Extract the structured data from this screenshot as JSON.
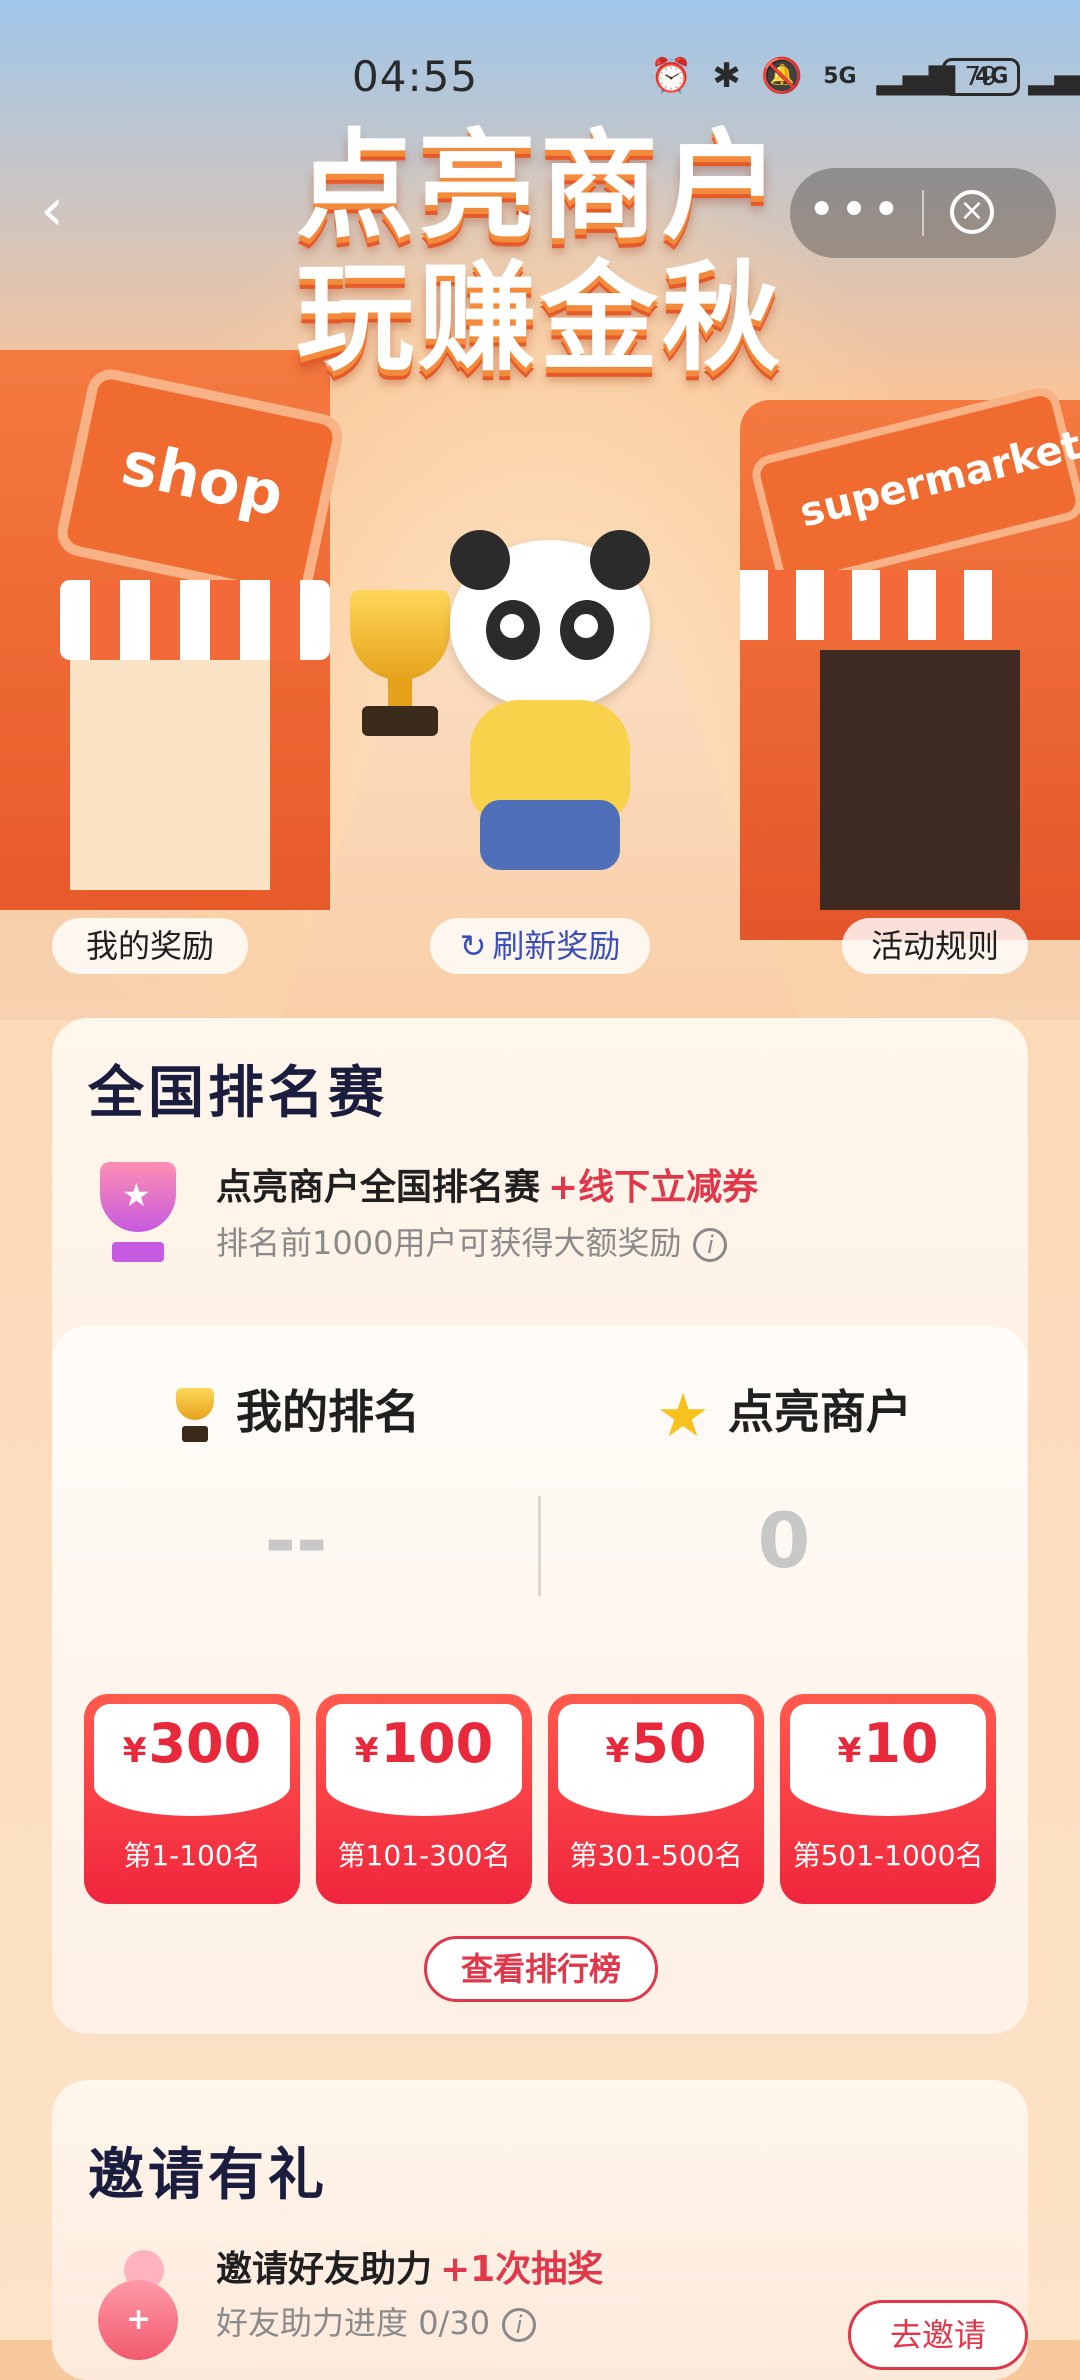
{
  "status_bar": {
    "time": "04:55",
    "network_1": "5G",
    "network_2": "4G",
    "battery": "79",
    "icons": [
      "alarm-icon",
      "bluetooth-icon",
      "mute-icon",
      "signal-icon",
      "signal-icon",
      "battery-icon"
    ]
  },
  "nav": {
    "back_icon": "chevron-left-icon",
    "more_label": "•••",
    "close_icon": "close-circle-icon"
  },
  "hero": {
    "title_line1": "点亮商户",
    "title_line2": "玩赚金秋",
    "shop_sign": "shop",
    "market_sign": "supermarket",
    "pill_my_rewards": "我的奖励",
    "pill_refresh": "刷新奖励",
    "pill_rules": "活动规则"
  },
  "ranking": {
    "section_title": "全国排名赛",
    "event_name": "点亮商户全国排名赛",
    "event_tag": "+线下立减券",
    "event_sub": "排名前1000用户可获得大额奖励",
    "my_rank_label": "我的排名",
    "my_rank_value": "--",
    "lit_label": "点亮商户",
    "lit_value": "0",
    "coupons": [
      {
        "amount": "300",
        "range": "第1-100名"
      },
      {
        "amount": "100",
        "range": "第101-300名"
      },
      {
        "amount": "50",
        "range": "第301-500名"
      },
      {
        "amount": "10",
        "range": "第501-1000名"
      }
    ],
    "currency": "¥",
    "view_board_button": "查看排行榜"
  },
  "invite": {
    "section_title": "邀请有礼",
    "name": "邀请好友助力",
    "tag": "+1次抽奖",
    "progress_label": "好友助力进度",
    "progress_value": "0/30",
    "button": "去邀请"
  },
  "colors": {
    "accent_red": "#e0374a",
    "coupon_red": "#f0253d",
    "title_navy": "#1a1d3d",
    "refresh_blue": "#3b4fb8"
  }
}
